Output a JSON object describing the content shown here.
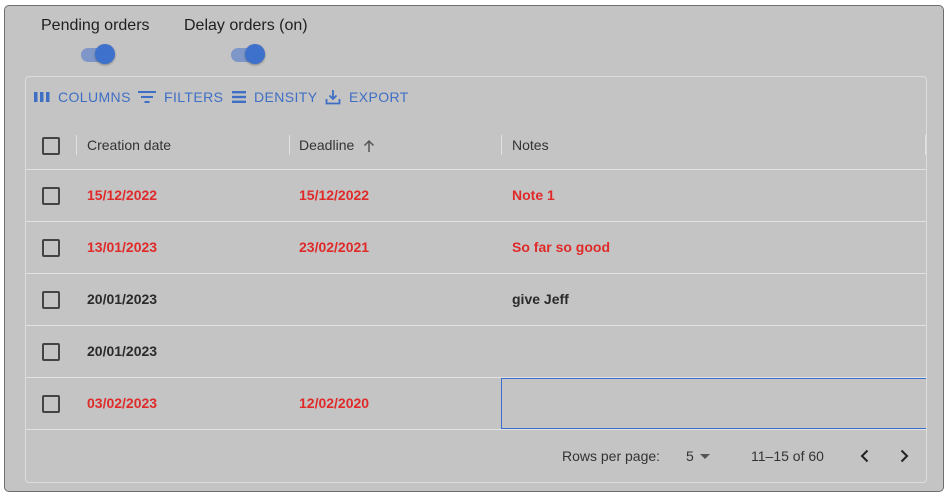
{
  "toggles": {
    "pending": {
      "label": "Pending orders",
      "on": true
    },
    "delay": {
      "label": "Delay orders (on)",
      "on": true
    }
  },
  "toolbar": {
    "columns": "COLUMNS",
    "filters": "FILTERS",
    "density": "DENSITY",
    "export": "EXPORT"
  },
  "columns": {
    "creation": "Creation date",
    "deadline": "Deadline",
    "notes": "Notes"
  },
  "rows": [
    {
      "creation": "15/12/2022",
      "deadline": "15/12/2022",
      "notes": "Note 1",
      "highlight": true
    },
    {
      "creation": "13/01/2023",
      "deadline": "23/02/2021",
      "notes": "So far so good",
      "highlight": true
    },
    {
      "creation": "20/01/2023",
      "deadline": "",
      "notes": "give Jeff",
      "highlight": false
    },
    {
      "creation": "20/01/2023",
      "deadline": "",
      "notes": "",
      "highlight": false
    },
    {
      "creation": "03/02/2023",
      "deadline": "12/02/2020",
      "notes": "",
      "highlight": true
    }
  ],
  "pagination": {
    "rows_per_page_label": "Rows per page:",
    "rows_per_page_value": "5",
    "range": "11–15 of 60"
  },
  "colors": {
    "accent": "#3f6fc4",
    "late": "#e02a2a",
    "background": "#c4c4c4"
  }
}
